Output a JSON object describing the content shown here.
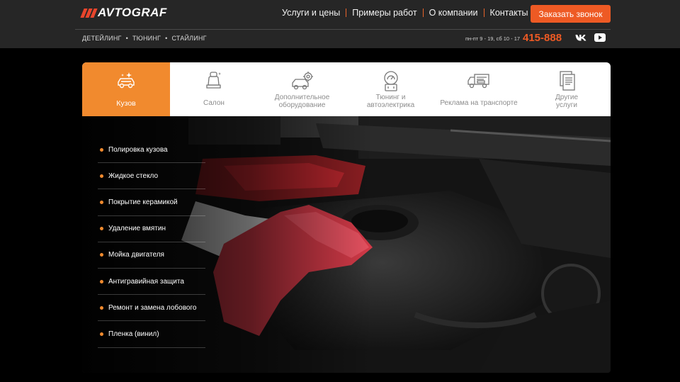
{
  "header": {
    "logo_text": "AVTOGRAF",
    "nav": [
      {
        "label": "Услуги и цены"
      },
      {
        "label": "Примеры работ"
      },
      {
        "label": "О компании"
      },
      {
        "label": "Контакты"
      }
    ],
    "cta_label": "Заказать звонок",
    "subnav": [
      "ДЕТЕЙЛИНГ",
      "ТЮНИНГ",
      "СТАЙЛИНГ"
    ],
    "hours": "пн-пт 9 - 19, сб 10 - 17",
    "phone": "415-888",
    "social": [
      "vk-icon",
      "youtube-icon"
    ]
  },
  "tabs": [
    {
      "label": "Кузов",
      "icon": "car-sparkle-icon",
      "active": true
    },
    {
      "label": "Салон",
      "icon": "car-seat-icon"
    },
    {
      "label": "Дополнительное оборудование",
      "line1": "Дополнительное",
      "line2": "оборудование",
      "icon": "car-gear-icon"
    },
    {
      "label": "Тюнинг и автоэлектрика",
      "line1": "Тюнинг и",
      "line2": "автоэлектрика",
      "icon": "battery-gauge-icon"
    },
    {
      "label": "Реклама на транспорте",
      "icon": "truck-ad-icon"
    },
    {
      "label": "Другие услуги",
      "line1": "Другие",
      "line2": "услуги",
      "icon": "documents-icon"
    }
  ],
  "services": [
    "Полировка кузова",
    "Жидкое стекло",
    "Покрытие керамикой",
    "Удаление вмятин",
    "Мойка двигателя",
    "Антигравийная защита",
    "Ремонт и замена лобового",
    "Пленка (винил)"
  ],
  "colors": {
    "accent": "#f18a2e",
    "cta": "#ee5a24",
    "header_bg": "#262626"
  }
}
